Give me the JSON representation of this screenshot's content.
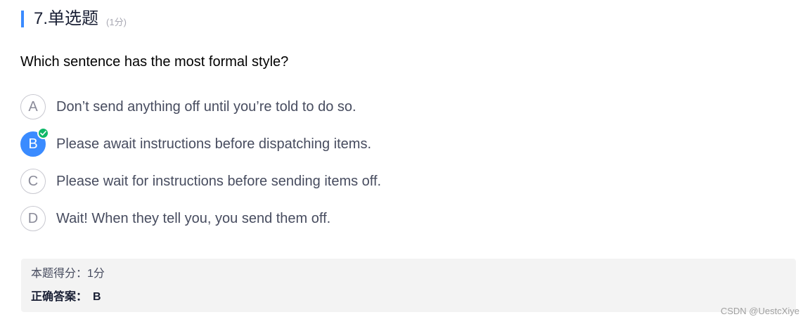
{
  "question": {
    "title": "7.单选题",
    "points": "(1分)",
    "stem": "Which sentence has the most formal style?"
  },
  "options": [
    {
      "letter": "A",
      "text": "Don’t send anything off until you’re told to do so.",
      "selected": false
    },
    {
      "letter": "B",
      "text": "Please await instructions before dispatching items.",
      "selected": true
    },
    {
      "letter": "C",
      "text": "Please wait for instructions before sending items off.",
      "selected": false
    },
    {
      "letter": "D",
      "text": "Wait! When they tell you, you send them off.",
      "selected": false
    }
  ],
  "result": {
    "score_label": "本题得分：1分",
    "correct_label": "正确答案：",
    "correct_value": "B"
  },
  "watermark": "CSDN @UestcXiye",
  "colors": {
    "accent": "#3a8bff",
    "check": "#0fb869",
    "answer_bg": "#f3f3f3"
  }
}
